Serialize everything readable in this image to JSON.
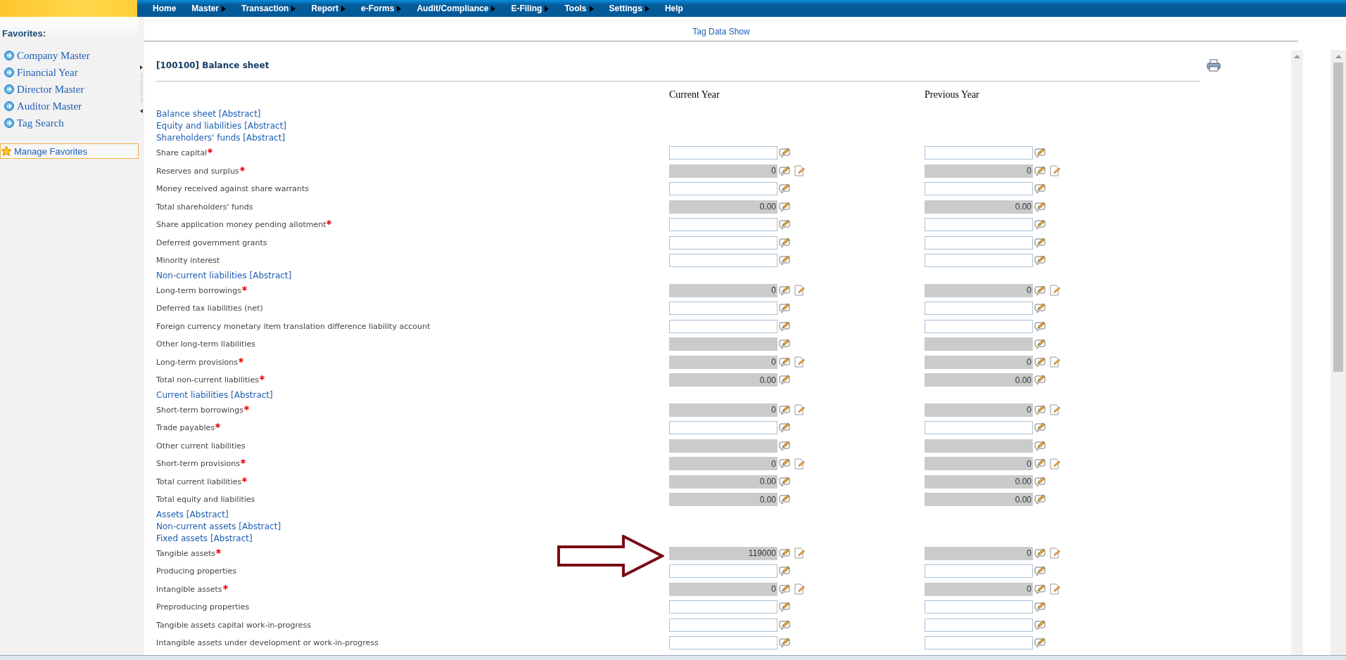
{
  "menu": [
    {
      "label": "Home",
      "submenu": false
    },
    {
      "label": "Master",
      "submenu": true
    },
    {
      "label": "Transaction",
      "submenu": true
    },
    {
      "label": "Report",
      "submenu": true
    },
    {
      "label": "e-Forms",
      "submenu": true
    },
    {
      "label": "Audit/Compliance",
      "submenu": true
    },
    {
      "label": "E-Filing",
      "submenu": true
    },
    {
      "label": "Tools",
      "submenu": true
    },
    {
      "label": "Settings",
      "submenu": true
    },
    {
      "label": "Help",
      "submenu": false
    }
  ],
  "sidebar": {
    "title": "Favorites:",
    "items": [
      "Company Master",
      "Financial Year",
      "Director Master",
      "Auditor Master",
      "Tag Search"
    ],
    "manage": "Manage Favorites"
  },
  "page_title": "Tag Data Show",
  "section_title": "[100100] Balance sheet",
  "columns": [
    "Current Year",
    "Previous Year"
  ],
  "rows": [
    {
      "kind": "abstract",
      "label": "Balance sheet [Abstract]"
    },
    {
      "kind": "abstract",
      "label": "Equity and liabilities [Abstract]"
    },
    {
      "kind": "abstract",
      "label": "Shareholders' funds [Abstract]"
    },
    {
      "kind": "field",
      "label": "Share capital",
      "required": true,
      "cells": [
        {
          "readonly": false,
          "detail": false
        },
        {
          "readonly": false,
          "detail": false
        }
      ]
    },
    {
      "kind": "field",
      "label": "Reserves and surplus",
      "required": true,
      "cells": [
        {
          "value": "0",
          "readonly": true,
          "detail": true
        },
        {
          "value": "0",
          "readonly": true,
          "detail": true
        }
      ]
    },
    {
      "kind": "field",
      "label": "Money received against share warrants",
      "required": false,
      "cells": [
        {
          "readonly": false,
          "detail": false
        },
        {
          "readonly": false,
          "detail": false
        }
      ]
    },
    {
      "kind": "field",
      "label": "Total shareholders' funds",
      "required": false,
      "cells": [
        {
          "value": "0.00",
          "readonly": true,
          "detail": false
        },
        {
          "value": "0.00",
          "readonly": true,
          "detail": false
        }
      ]
    },
    {
      "kind": "field",
      "label": "Share application money pending allotment",
      "required": true,
      "cells": [
        {
          "readonly": false,
          "detail": false
        },
        {
          "readonly": false,
          "detail": false
        }
      ]
    },
    {
      "kind": "field",
      "label": "Deferred government grants",
      "required": false,
      "cells": [
        {
          "readonly": false,
          "detail": false
        },
        {
          "readonly": false,
          "detail": false
        }
      ]
    },
    {
      "kind": "field",
      "label": "Minority interest",
      "required": false,
      "cells": [
        {
          "readonly": false,
          "detail": false
        },
        {
          "readonly": false,
          "detail": false
        }
      ]
    },
    {
      "kind": "abstract",
      "label": "Non-current liabilities [Abstract]"
    },
    {
      "kind": "field",
      "label": "Long-term borrowings",
      "required": true,
      "cells": [
        {
          "value": "0",
          "readonly": true,
          "detail": true
        },
        {
          "value": "0",
          "readonly": true,
          "detail": true
        }
      ]
    },
    {
      "kind": "field",
      "label": "Deferred tax liabilities (net)",
      "required": false,
      "cells": [
        {
          "readonly": false,
          "detail": false
        },
        {
          "readonly": false,
          "detail": false
        }
      ]
    },
    {
      "kind": "field",
      "label": "Foreign currency monetary item translation difference liability account",
      "required": false,
      "cells": [
        {
          "readonly": false,
          "detail": false
        },
        {
          "readonly": false,
          "detail": false
        }
      ]
    },
    {
      "kind": "field",
      "label": "Other long-term liabilities",
      "required": false,
      "cells": [
        {
          "readonly": true,
          "detail": false
        },
        {
          "readonly": true,
          "detail": false
        }
      ]
    },
    {
      "kind": "field",
      "label": "Long-term provisions",
      "required": true,
      "cells": [
        {
          "value": "0",
          "readonly": true,
          "detail": true
        },
        {
          "value": "0",
          "readonly": true,
          "detail": true
        }
      ]
    },
    {
      "kind": "field",
      "label": "Total non-current liabilities",
      "required": true,
      "cells": [
        {
          "value": "0.00",
          "readonly": true,
          "detail": false
        },
        {
          "value": "0.00",
          "readonly": true,
          "detail": false
        }
      ]
    },
    {
      "kind": "abstract",
      "label": "Current liabilities [Abstract]"
    },
    {
      "kind": "field",
      "label": "Short-term borrowings",
      "required": true,
      "cells": [
        {
          "value": "0",
          "readonly": true,
          "detail": true
        },
        {
          "value": "0",
          "readonly": true,
          "detail": true
        }
      ]
    },
    {
      "kind": "field",
      "label": "Trade payables",
      "required": true,
      "cells": [
        {
          "readonly": false,
          "detail": false
        },
        {
          "readonly": false,
          "detail": false
        }
      ]
    },
    {
      "kind": "field",
      "label": "Other current liabilities",
      "required": false,
      "cells": [
        {
          "readonly": true,
          "detail": false
        },
        {
          "readonly": true,
          "detail": false
        }
      ]
    },
    {
      "kind": "field",
      "label": "Short-term provisions",
      "required": true,
      "cells": [
        {
          "value": "0",
          "readonly": true,
          "detail": true
        },
        {
          "value": "0",
          "readonly": true,
          "detail": true
        }
      ]
    },
    {
      "kind": "field",
      "label": "Total current liabilities",
      "required": true,
      "cells": [
        {
          "value": "0.00",
          "readonly": true,
          "detail": false
        },
        {
          "value": "0.00",
          "readonly": true,
          "detail": false
        }
      ]
    },
    {
      "kind": "field",
      "label": "Total equity and liabilities",
      "required": false,
      "cells": [
        {
          "value": "0.00",
          "readonly": true,
          "detail": false
        },
        {
          "value": "0.00",
          "readonly": true,
          "detail": false
        }
      ]
    },
    {
      "kind": "abstract",
      "label": "Assets [Abstract]"
    },
    {
      "kind": "abstract",
      "label": "Non-current assets [Abstract]"
    },
    {
      "kind": "abstract",
      "label": "Fixed assets [Abstract]"
    },
    {
      "kind": "field",
      "label": "Tangible assets",
      "required": true,
      "pointer_arrow": true,
      "cells": [
        {
          "value": "119000",
          "readonly": true,
          "detail": true
        },
        {
          "value": "0",
          "readonly": true,
          "detail": true
        }
      ]
    },
    {
      "kind": "field",
      "label": "Producing properties",
      "required": false,
      "cells": [
        {
          "readonly": false,
          "detail": false
        },
        {
          "readonly": false,
          "detail": false
        }
      ]
    },
    {
      "kind": "field",
      "label": "Intangible assets",
      "required": true,
      "cells": [
        {
          "value": "0",
          "readonly": true,
          "detail": true
        },
        {
          "value": "0",
          "readonly": true,
          "detail": true
        }
      ]
    },
    {
      "kind": "field",
      "label": "Preproducing properties",
      "required": false,
      "cells": [
        {
          "readonly": false,
          "detail": false
        },
        {
          "readonly": false,
          "detail": false
        }
      ]
    },
    {
      "kind": "field",
      "label": "Tangible assets capital work-in-progress",
      "required": false,
      "cells": [
        {
          "readonly": false,
          "detail": false
        },
        {
          "readonly": false,
          "detail": false
        }
      ]
    },
    {
      "kind": "field",
      "label": "Intangible assets under development or work-in-progress",
      "required": false,
      "cells": [
        {
          "readonly": false,
          "detail": false
        },
        {
          "readonly": false,
          "detail": false
        }
      ]
    }
  ]
}
